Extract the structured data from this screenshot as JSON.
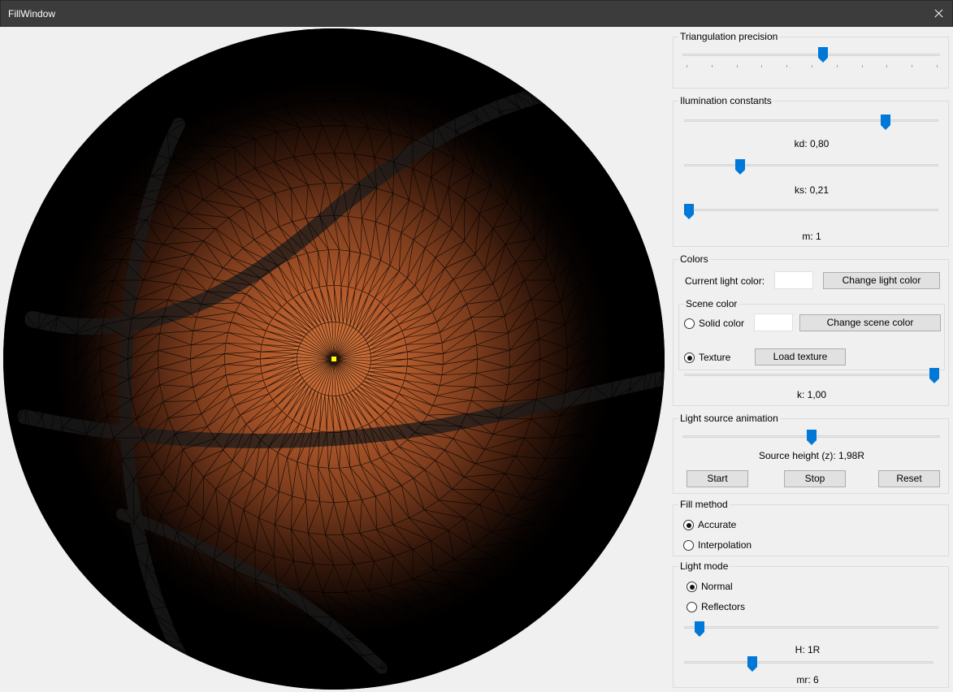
{
  "window": {
    "title": "FillWindow"
  },
  "triangulation": {
    "label": "Triangulation precision",
    "value_fraction": 0.5,
    "tick_count": 10
  },
  "illumination": {
    "label": "Ilumination constants",
    "kd": {
      "label": "kd: 0,80",
      "value": 0.8
    },
    "ks": {
      "label": "ks: 0,21",
      "value": 0.21
    },
    "m": {
      "label": "m: 1",
      "value_fraction": 0.0
    }
  },
  "colors": {
    "label": "Colors",
    "current_light_label": "Current light color:",
    "light_color": "#ffffff",
    "change_light_button": "Change light color",
    "scene": {
      "label": "Scene color",
      "solid_label": "Solid color",
      "solid_checked": false,
      "scene_color": "#ffffff",
      "change_scene_button": "Change scene color",
      "texture_label": "Texture",
      "texture_checked": true,
      "load_texture_button": "Load texture"
    },
    "k": {
      "label": "k: 1,00",
      "value": 1.0
    }
  },
  "animation": {
    "label": "Light source animation",
    "height_label": "Source height (z): 1,98R",
    "value_fraction": 0.5,
    "start_button": "Start",
    "stop_button": "Stop",
    "reset_button": "Reset"
  },
  "fill_method": {
    "label": "Fill method",
    "accurate_label": "Accurate",
    "accurate_checked": true,
    "interpolation_label": "Interpolation",
    "interpolation_checked": false
  },
  "light_mode": {
    "label": "Light mode",
    "normal_label": "Normal",
    "normal_checked": true,
    "reflectors_label": "Reflectors",
    "reflectors_checked": false,
    "h": {
      "label": "H: 1R",
      "value_fraction": 0.05
    },
    "mr": {
      "label": "mr: 6",
      "value_fraction": 0.27
    }
  },
  "accent": "#0078d7",
  "light_source_color": "#ffff00"
}
